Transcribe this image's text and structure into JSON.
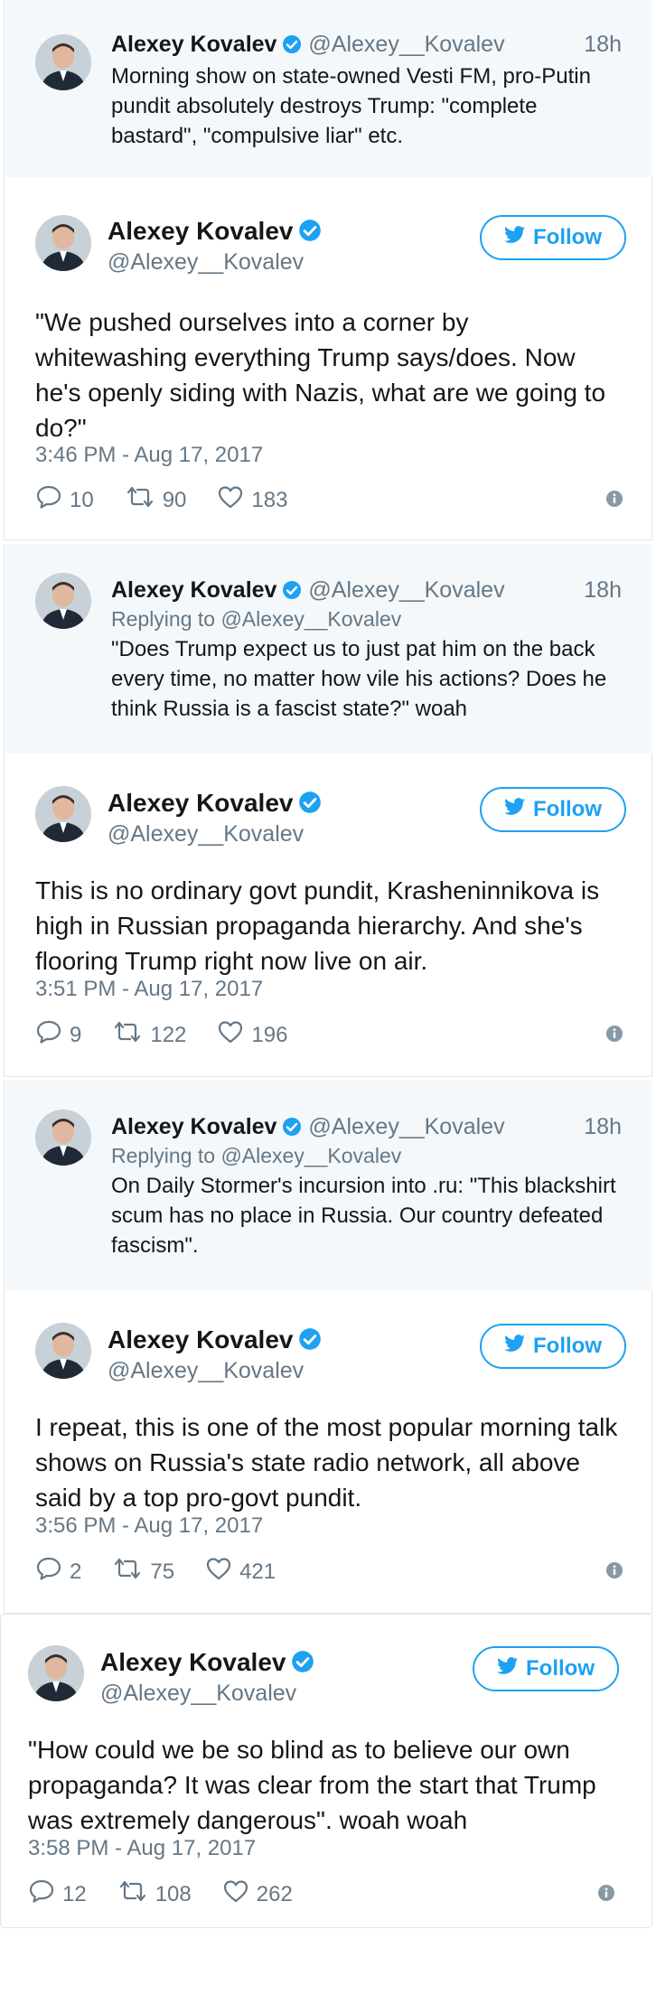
{
  "colors": {
    "accent": "#1da1f2",
    "muted": "#657786",
    "context_bg": "#f5f8fa"
  },
  "icons": {
    "verified": "verified-badge-icon",
    "follow": "twitter-bird-icon",
    "reply": "reply-icon",
    "retweet": "retweet-icon",
    "like": "heart-icon",
    "info": "info-icon"
  },
  "ctx1": {
    "name": "Alexey Kovalev",
    "handle": "@Alexey__Kovalev",
    "time": "18h",
    "lines": [
      "Morning show on state-owned Vesti FM, pro-Putin",
      "pundit absolutely destroys Trump: \"complete",
      "bastard\", \"compulsive liar\" etc."
    ]
  },
  "t1": {
    "name": "Alexey Kovalev",
    "handle": "@Alexey__Kovalev",
    "follow": "Follow",
    "lines": [
      "\"We pushed ourselves into a corner by",
      "whitewashing everything Trump says/does. Now",
      "he's openly siding with Nazis, what are we going to",
      "do?\""
    ],
    "timestamp": "3:46 PM - Aug 17, 2017",
    "replies": "10",
    "retweets": "90",
    "likes": "183"
  },
  "ctx2": {
    "name": "Alexey Kovalev",
    "handle": "@Alexey__Kovalev",
    "time": "18h",
    "reply_to": "Replying to @Alexey__Kovalev",
    "lines": [
      "\"Does Trump expect us to just pat him on the back",
      "every time, no matter how vile his actions? Does he",
      "think Russia is a fascist state?\" woah"
    ]
  },
  "t2": {
    "name": "Alexey Kovalev",
    "handle": "@Alexey__Kovalev",
    "follow": "Follow",
    "lines": [
      "This is no ordinary govt pundit, Krasheninnikova is",
      "high in Russian propaganda hierarchy. And she's",
      "flooring Trump right now live on air."
    ],
    "timestamp": "3:51 PM - Aug 17, 2017",
    "replies": "9",
    "retweets": "122",
    "likes": "196"
  },
  "ctx3": {
    "name": "Alexey Kovalev",
    "handle": "@Alexey__Kovalev",
    "time": "18h",
    "reply_to": "Replying to @Alexey__Kovalev",
    "lines": [
      "On Daily Stormer's incursion into .ru: \"This blackshirt",
      "scum has no place in Russia. Our country defeated",
      "fascism\"."
    ]
  },
  "t3": {
    "name": "Alexey Kovalev",
    "handle": "@Alexey__Kovalev",
    "follow": "Follow",
    "lines": [
      "I repeat, this is one of the most popular morning talk",
      "shows on Russia's state radio network, all above",
      "said by a top pro-govt pundit."
    ],
    "timestamp": "3:56 PM - Aug 17, 2017",
    "replies": "2",
    "retweets": "75",
    "likes": "421"
  },
  "t4": {
    "name": "Alexey Kovalev",
    "handle": "@Alexey__Kovalev",
    "follow": "Follow",
    "lines": [
      "\"How could we be so blind as to believe our own",
      "propaganda? It was clear from the start that Trump",
      "was extremely dangerous\". woah woah"
    ],
    "timestamp": "3:58 PM - Aug 17, 2017",
    "replies": "12",
    "retweets": "108",
    "likes": "262"
  }
}
